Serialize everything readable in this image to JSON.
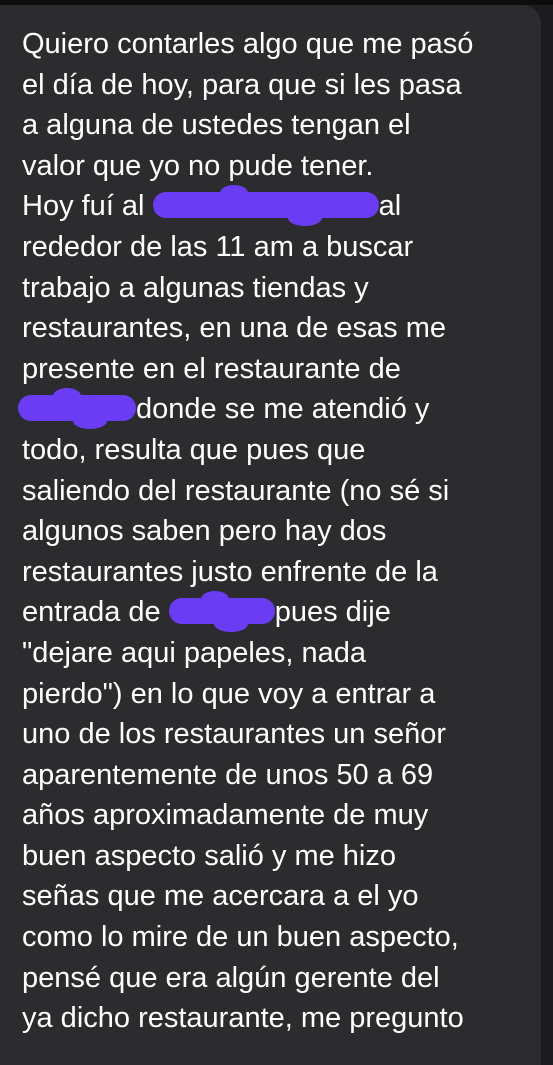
{
  "message": {
    "lines": [
      {
        "id": "l1",
        "segs": [
          "Quiero contarles algo que me pasó"
        ]
      },
      {
        "id": "l2",
        "segs": [
          "el día de hoy, para que si les pasa"
        ]
      },
      {
        "id": "l3",
        "segs": [
          "a alguna de ustedes tengan el"
        ]
      },
      {
        "id": "l4",
        "segs": [
          "valor que yo no pude tener."
        ]
      },
      {
        "id": "l5",
        "segs": [
          "Hoy fuí al ",
          "al"
        ]
      },
      {
        "id": "l6",
        "segs": [
          "rededor de las 11 am a buscar"
        ]
      },
      {
        "id": "l7",
        "segs": [
          "trabajo a algunas tiendas y"
        ]
      },
      {
        "id": "l8",
        "segs": [
          "restaurantes, en una de esas me"
        ]
      },
      {
        "id": "l9",
        "segs": [
          "presente en el restaurante de"
        ]
      },
      {
        "id": "l10",
        "segs": [
          "",
          "donde se me atendió y"
        ]
      },
      {
        "id": "l11",
        "segs": [
          "todo, resulta que pues que"
        ]
      },
      {
        "id": "l12",
        "segs": [
          "saliendo del restaurante (no sé si"
        ]
      },
      {
        "id": "l13",
        "segs": [
          "algunos saben pero hay dos"
        ]
      },
      {
        "id": "l14",
        "segs": [
          "restaurantes justo enfrente de la"
        ]
      },
      {
        "id": "l15",
        "segs": [
          "entrada de ",
          "pues dije"
        ]
      },
      {
        "id": "l16",
        "segs": [
          "\"dejare aqui papeles, nada"
        ]
      },
      {
        "id": "l17",
        "segs": [
          "pierdo\") en lo que voy a entrar a"
        ]
      },
      {
        "id": "l18",
        "segs": [
          "uno de los restaurantes un señor"
        ]
      },
      {
        "id": "l19",
        "segs": [
          "aparentemente de unos 50 a 69"
        ]
      },
      {
        "id": "l20",
        "segs": [
          "años aproximadamente de muy"
        ]
      },
      {
        "id": "l21",
        "segs": [
          "buen aspecto salió y me hizo"
        ]
      },
      {
        "id": "l22",
        "segs": [
          "señas que me acercara a el yo"
        ]
      },
      {
        "id": "l23",
        "segs": [
          "como lo mire de un buen aspecto,"
        ]
      },
      {
        "id": "l24",
        "segs": [
          "pensé que era algún gerente del"
        ]
      },
      {
        "id": "l25",
        "segs": [
          "ya dicho restaurante, me pregunto"
        ]
      }
    ]
  },
  "colors": {
    "background": "#1c1c1e",
    "bubble": "#2c2c2e",
    "text": "#ffffff",
    "redaction": "#6a3df5"
  }
}
